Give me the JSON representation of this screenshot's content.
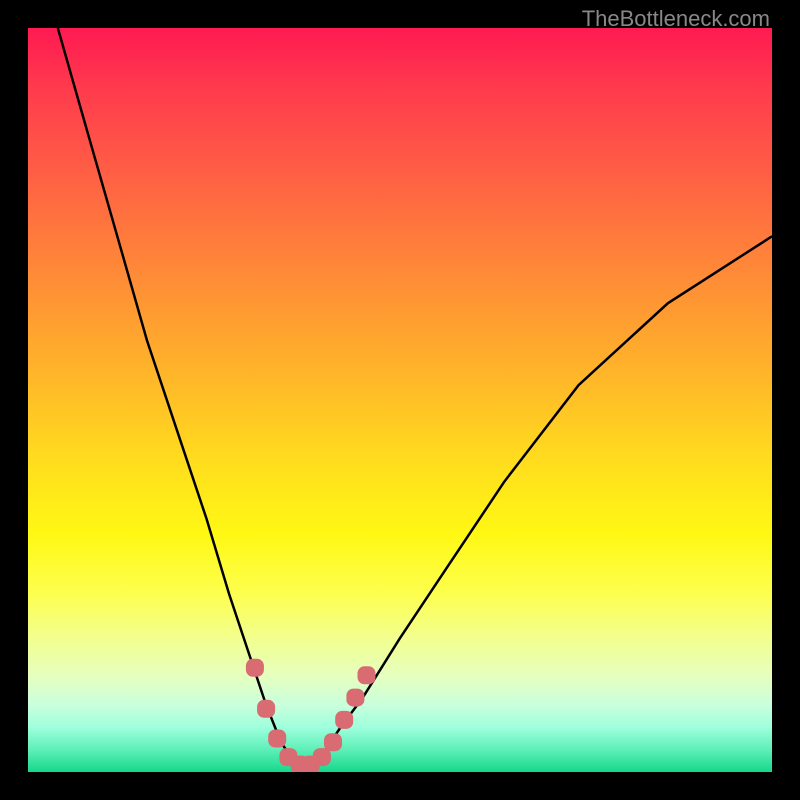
{
  "watermark": "TheBottleneck.com",
  "colors": {
    "background": "#000000",
    "curve": "#000000",
    "marker": "#d96b72",
    "gradient_top": "#ff1a52",
    "gradient_bottom": "#15d88a"
  },
  "chart_data": {
    "type": "line",
    "title": "",
    "xlabel": "",
    "ylabel": "",
    "xlim": [
      0,
      100
    ],
    "ylim": [
      0,
      100
    ],
    "grid": false,
    "note": "V-shaped bottleneck curve on rainbow gradient; y=0 (bottom/green) is optimal, y=100 (top/red) is worst. Minimum around x≈36.",
    "series": [
      {
        "name": "bottleneck-curve",
        "x": [
          4,
          8,
          12,
          16,
          20,
          24,
          27,
          30,
          32,
          34,
          36,
          38,
          40,
          42,
          45,
          50,
          56,
          64,
          74,
          86,
          100
        ],
        "y": [
          100,
          86,
          72,
          58,
          46,
          34,
          24,
          15,
          9,
          4,
          1,
          1,
          3,
          6,
          10,
          18,
          27,
          39,
          52,
          63,
          72
        ]
      }
    ],
    "markers": {
      "name": "optimal-zone",
      "x": [
        30.5,
        32,
        33.5,
        35,
        36.5,
        38,
        39.5,
        41,
        42.5,
        44,
        45.5
      ],
      "y": [
        14,
        8.5,
        4.5,
        2,
        1,
        1,
        2,
        4,
        7,
        10,
        13
      ]
    }
  }
}
